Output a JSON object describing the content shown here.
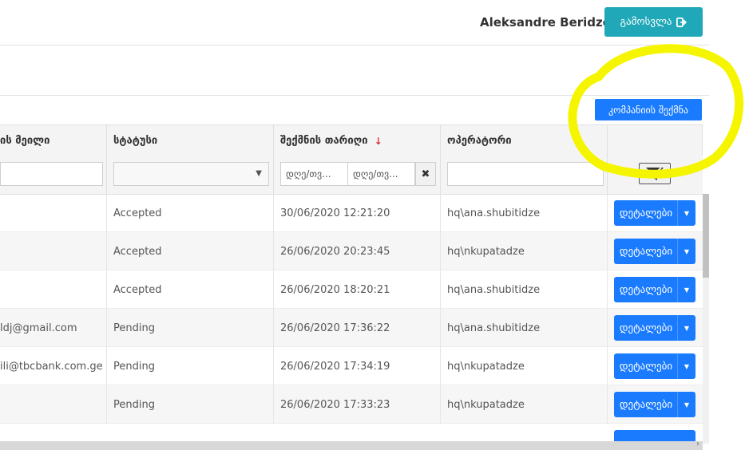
{
  "header": {
    "username": "Aleksandre Beridze",
    "logout_label": "გამოსვლა"
  },
  "toolbar": {
    "create_company_label": "კომპანიის შექმნა"
  },
  "table": {
    "columns": [
      {
        "label": "ის მეილი"
      },
      {
        "label": "სტატუსი"
      },
      {
        "label": "შექმნის თარიღი",
        "sort": "desc"
      },
      {
        "label": "ოპერატორი"
      },
      {
        "label": ""
      }
    ],
    "filters": {
      "date_from_placeholder": "დღე/თვ...",
      "date_to_placeholder": "დღე/თვ...",
      "clear_icon": "close-icon",
      "filter_icon": "filter-clear-icon"
    },
    "rows": [
      {
        "email": "",
        "status": "Accepted",
        "created": "30/06/2020 12:21:20",
        "operator": "hq\\ana.shubitidze",
        "action": "დეტალები"
      },
      {
        "email": "",
        "status": "Accepted",
        "created": "26/06/2020 20:23:45",
        "operator": "hq\\nkupatadze",
        "action": "დეტალები"
      },
      {
        "email": "",
        "status": "Accepted",
        "created": "26/06/2020 18:20:21",
        "operator": "hq\\ana.shubitidze",
        "action": "დეტალები"
      },
      {
        "email": "ldj@gmail.com",
        "status": "Pending",
        "created": "26/06/2020 17:36:22",
        "operator": "hq\\ana.shubitidze",
        "action": "დეტალები"
      },
      {
        "email": "ili@tbcbank.com.ge",
        "status": "Pending",
        "created": "26/06/2020 17:34:19",
        "operator": "hq\\nkupatadze",
        "action": "დეტალები"
      },
      {
        "email": "",
        "status": "Pending",
        "created": "26/06/2020 17:33:23",
        "operator": "hq\\nkupatadze",
        "action": "დეტალები"
      }
    ]
  },
  "colors": {
    "logout_button": "#20a8b8",
    "primary_button": "#1a7bff",
    "annotation": "#f5f500",
    "sort_arrow": "#e03030"
  }
}
